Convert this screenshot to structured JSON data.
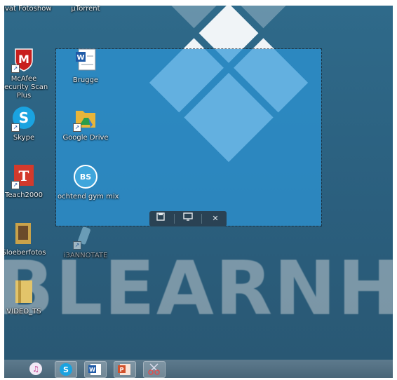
{
  "desktop_icons": [
    {
      "label": "odvat Fotoshow"
    },
    {
      "label": "µTorrent"
    },
    {
      "label": "McAfee Security Scan Plus"
    },
    {
      "label": "Skype"
    },
    {
      "label": "Teach2000"
    },
    {
      "label": "Sloeberfotos"
    },
    {
      "label": "i3ANNOTATE"
    },
    {
      "label": "VIDEO_TS"
    }
  ],
  "selection_icons": [
    {
      "label": "Brugge"
    },
    {
      "label": "Google Drive"
    },
    {
      "label": "ochtend gym mix",
      "badge": "BS"
    }
  ],
  "wallpaper": {
    "wordmark": "BLEARNHU"
  },
  "snip_toolbar": {
    "close_label": "✕"
  },
  "taskbar_items": [
    {
      "name": "itunes"
    },
    {
      "name": "skype"
    },
    {
      "name": "word"
    },
    {
      "name": "powerpoint"
    },
    {
      "name": "snipping-tool"
    }
  ],
  "colors": {
    "desktop": "#2f6a8a",
    "selection": "#2d96d7",
    "toolbar": "#2a4254"
  }
}
